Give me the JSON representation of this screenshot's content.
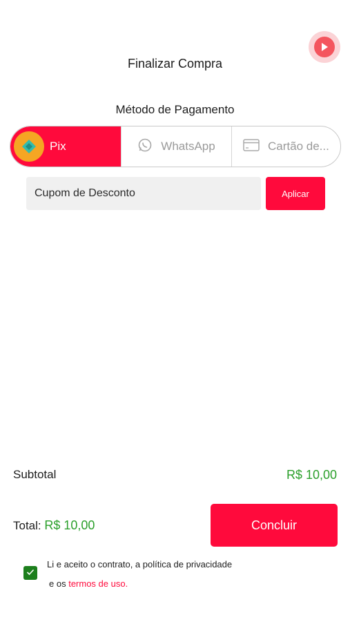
{
  "header": {
    "title": "Finalizar Compra",
    "play_icon": "play-icon"
  },
  "payment": {
    "section_title": "Método de Pagamento",
    "methods": [
      {
        "label": "Pix",
        "icon": "pix-icon",
        "selected": true
      },
      {
        "label": "WhatsApp",
        "icon": "whatsapp-icon",
        "selected": false
      },
      {
        "label": "Cartão de...",
        "icon": "credit-card-icon",
        "selected": false
      }
    ]
  },
  "coupon": {
    "placeholder": "Cupom de Desconto",
    "value": "",
    "apply_label": "Aplicar"
  },
  "summary": {
    "subtotal_label": "Subtotal",
    "subtotal_value": "R$ 10,00",
    "total_label": "Total:",
    "total_value": "R$ 10,00"
  },
  "actions": {
    "conclude_label": "Concluir"
  },
  "terms": {
    "checked": true,
    "line1": "Li e aceito o contrato, a política de privacidade",
    "line2_prefix": "e os",
    "link_label": "termos de uso."
  },
  "colors": {
    "accent": "#ff0a3c",
    "price_green": "#2a9f2a",
    "pix_badge": "#f5a623",
    "checkbox": "#1d7f1d"
  }
}
